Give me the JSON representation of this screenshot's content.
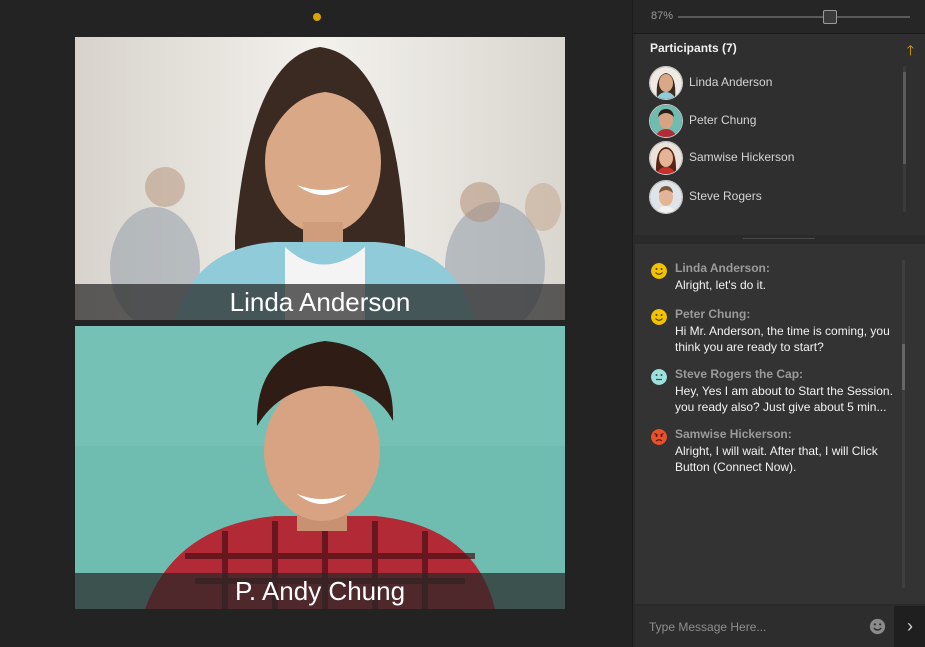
{
  "videos": [
    {
      "name": "Linda Anderson"
    },
    {
      "name": "P. Andy Chung"
    }
  ],
  "zoom": {
    "label": "87%",
    "level": 0.87
  },
  "participants": {
    "title": "Participants (7)",
    "items": [
      {
        "name": "Linda Anderson"
      },
      {
        "name": "Peter Chung"
      },
      {
        "name": "Samwise Hickerson"
      },
      {
        "name": "Steve Rogers"
      }
    ]
  },
  "chat": {
    "messages": [
      {
        "author": "Linda Anderson:",
        "text": "Alright, let's do it.",
        "emoji": "smile-emoji-icon",
        "color": "#f2c200"
      },
      {
        "author": "Peter Chung:",
        "text": "Hi Mr. Anderson, the time is coming, you think you are ready to start?",
        "emoji": "smile-emoji-icon",
        "color": "#f2c200"
      },
      {
        "author": "Steve Rogers the Cap:",
        "text": "Hey, Yes I am about to Start the Session. you ready also? Just give about 5 min...",
        "emoji": "neutral-emoji-icon",
        "color": "#9ee1dc"
      },
      {
        "author": "Samwise Hickerson:",
        "text": "Alright, I will wait. After that, I will Click Button (Connect Now).",
        "emoji": "angry-emoji-icon",
        "color": "#e8512a"
      }
    ],
    "input_placeholder": "Type Message Here..."
  },
  "colors": {
    "accent": "#e0a400",
    "panel": "#2f2f2f",
    "background": "#232323"
  }
}
